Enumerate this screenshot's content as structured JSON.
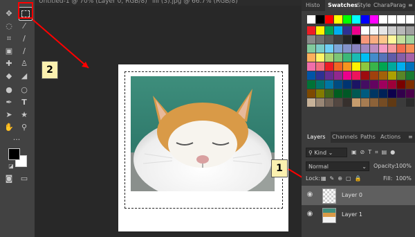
{
  "document_tabs": [
    {
      "title": "Untitled-1 @ 70% (Layer 0, RGB/8)"
    },
    {
      "title": "ilil (3).jpg @ 66.7% (RGB/8)"
    }
  ],
  "toolbar": {
    "tools": [
      "move-tool",
      "rectangular-marquee-tool",
      "lasso-tool",
      "magic-wand-tool",
      "crop-tool",
      "eyedropper-tool",
      "frame-tool",
      "healing-brush-tool",
      "brush-tool",
      "clone-stamp-tool",
      "history-brush-tool",
      "eraser-tool",
      "paint-bucket-tool",
      "blur-tool",
      "dodge-tool",
      "pen-tool",
      "type-tool",
      "path-selection-tool",
      "rectangle-tool",
      "hand-tool",
      "zoom-tool",
      "more-tools",
      "foreground-color",
      "background-color",
      "quick-mask",
      "screen-mode"
    ],
    "foreground_color": "#000000",
    "background_color": "#ffffff"
  },
  "top_panel_tabs": [
    {
      "label": "Histo"
    },
    {
      "label": "Swatches"
    },
    {
      "label": "Style"
    },
    {
      "label": "Chara"
    },
    {
      "label": "Parag"
    }
  ],
  "swatches": {
    "first_row": [
      "#ffffff",
      "#000000",
      "#ff0000",
      "#ffff00",
      "#00ff00",
      "#00ffff",
      "#0000ff",
      "#ff00ff",
      "#ffffff",
      "#ffffff",
      "#ffffff",
      "#ffffff"
    ],
    "grid": [
      [
        "#ed1c24",
        "#fff200",
        "#00a651",
        "#00aeef",
        "#2e3192",
        "#ec008c",
        "#ffffff",
        "#f5f5f5",
        "#e6e6e6",
        "#d0d0d0",
        "#b8b8b8",
        "#a0a0a0"
      ],
      [
        "#898989",
        "#707070",
        "#595959",
        "#3f3f3f",
        "#262626",
        "#000000",
        "#f7977a",
        "#f9ad81",
        "#fdc68a",
        "#fff79a",
        "#c4df9b",
        "#a2d39c"
      ],
      [
        "#82ca9d",
        "#7bcdc8",
        "#6ecff6",
        "#7ea7d8",
        "#8493ca",
        "#8882be",
        "#a187be",
        "#bc8cbf",
        "#f49ac2",
        "#f6989d",
        "#f26c4f",
        "#f68e55"
      ],
      [
        "#fbaf5c",
        "#fff467",
        "#acd372",
        "#7cc576",
        "#3bb878",
        "#1abbb4",
        "#00bff3",
        "#438ccb",
        "#5574b9",
        "#605ca8",
        "#855fa8",
        "#a763a8"
      ],
      [
        "#f06ea9",
        "#f26d7d",
        "#ed1c24",
        "#f26522",
        "#f7941d",
        "#fff200",
        "#8dc73f",
        "#39b54a",
        "#00a651",
        "#00a99d",
        "#00aeef",
        "#0072bc"
      ],
      [
        "#0054a6",
        "#2e3192",
        "#662d91",
        "#92278f",
        "#ec008c",
        "#ed145b",
        "#9e0b0f",
        "#a0410d",
        "#a36209",
        "#aba000",
        "#598527",
        "#197b30"
      ],
      [
        "#007236",
        "#00746b",
        "#0076a3",
        "#004b80",
        "#003471",
        "#1b1464",
        "#440e62",
        "#630460",
        "#9e005d",
        "#9e0039",
        "#790000",
        "#7b2e00"
      ],
      [
        "#7d4900",
        "#827b00",
        "#406618",
        "#005e20",
        "#005826",
        "#005952",
        "#005b7f",
        "#003663",
        "#002157",
        "#0d004c",
        "#32004b",
        "#4b0049"
      ],
      [
        "#c7b299",
        "#998675",
        "#736357",
        "#534741",
        "#37302d",
        "#c69c6d",
        "#a67c52",
        "#8c6239",
        "#754c24",
        "#603913",
        "#3b3b3b",
        "#2b2b2b"
      ]
    ]
  },
  "layers_panel": {
    "tabs": [
      {
        "label": "Layers"
      },
      {
        "label": "Channels"
      },
      {
        "label": "Paths"
      },
      {
        "label": "Actions"
      }
    ],
    "kind_label": "Kind",
    "blend_mode": "Normal",
    "opacity_label": "Opacity:",
    "opacity_value": "100%",
    "lock_label": "Lock:",
    "fill_label": "Fill:",
    "fill_value": "100%",
    "layers": [
      {
        "name": "Layer 0",
        "selected": true
      },
      {
        "name": "Layer 1",
        "selected": false
      }
    ]
  },
  "callouts": [
    {
      "number": "1"
    },
    {
      "number": "2"
    }
  ],
  "colors": {
    "callout_arrow": "#ff0000",
    "callout_fill": "#fbf1b0"
  }
}
